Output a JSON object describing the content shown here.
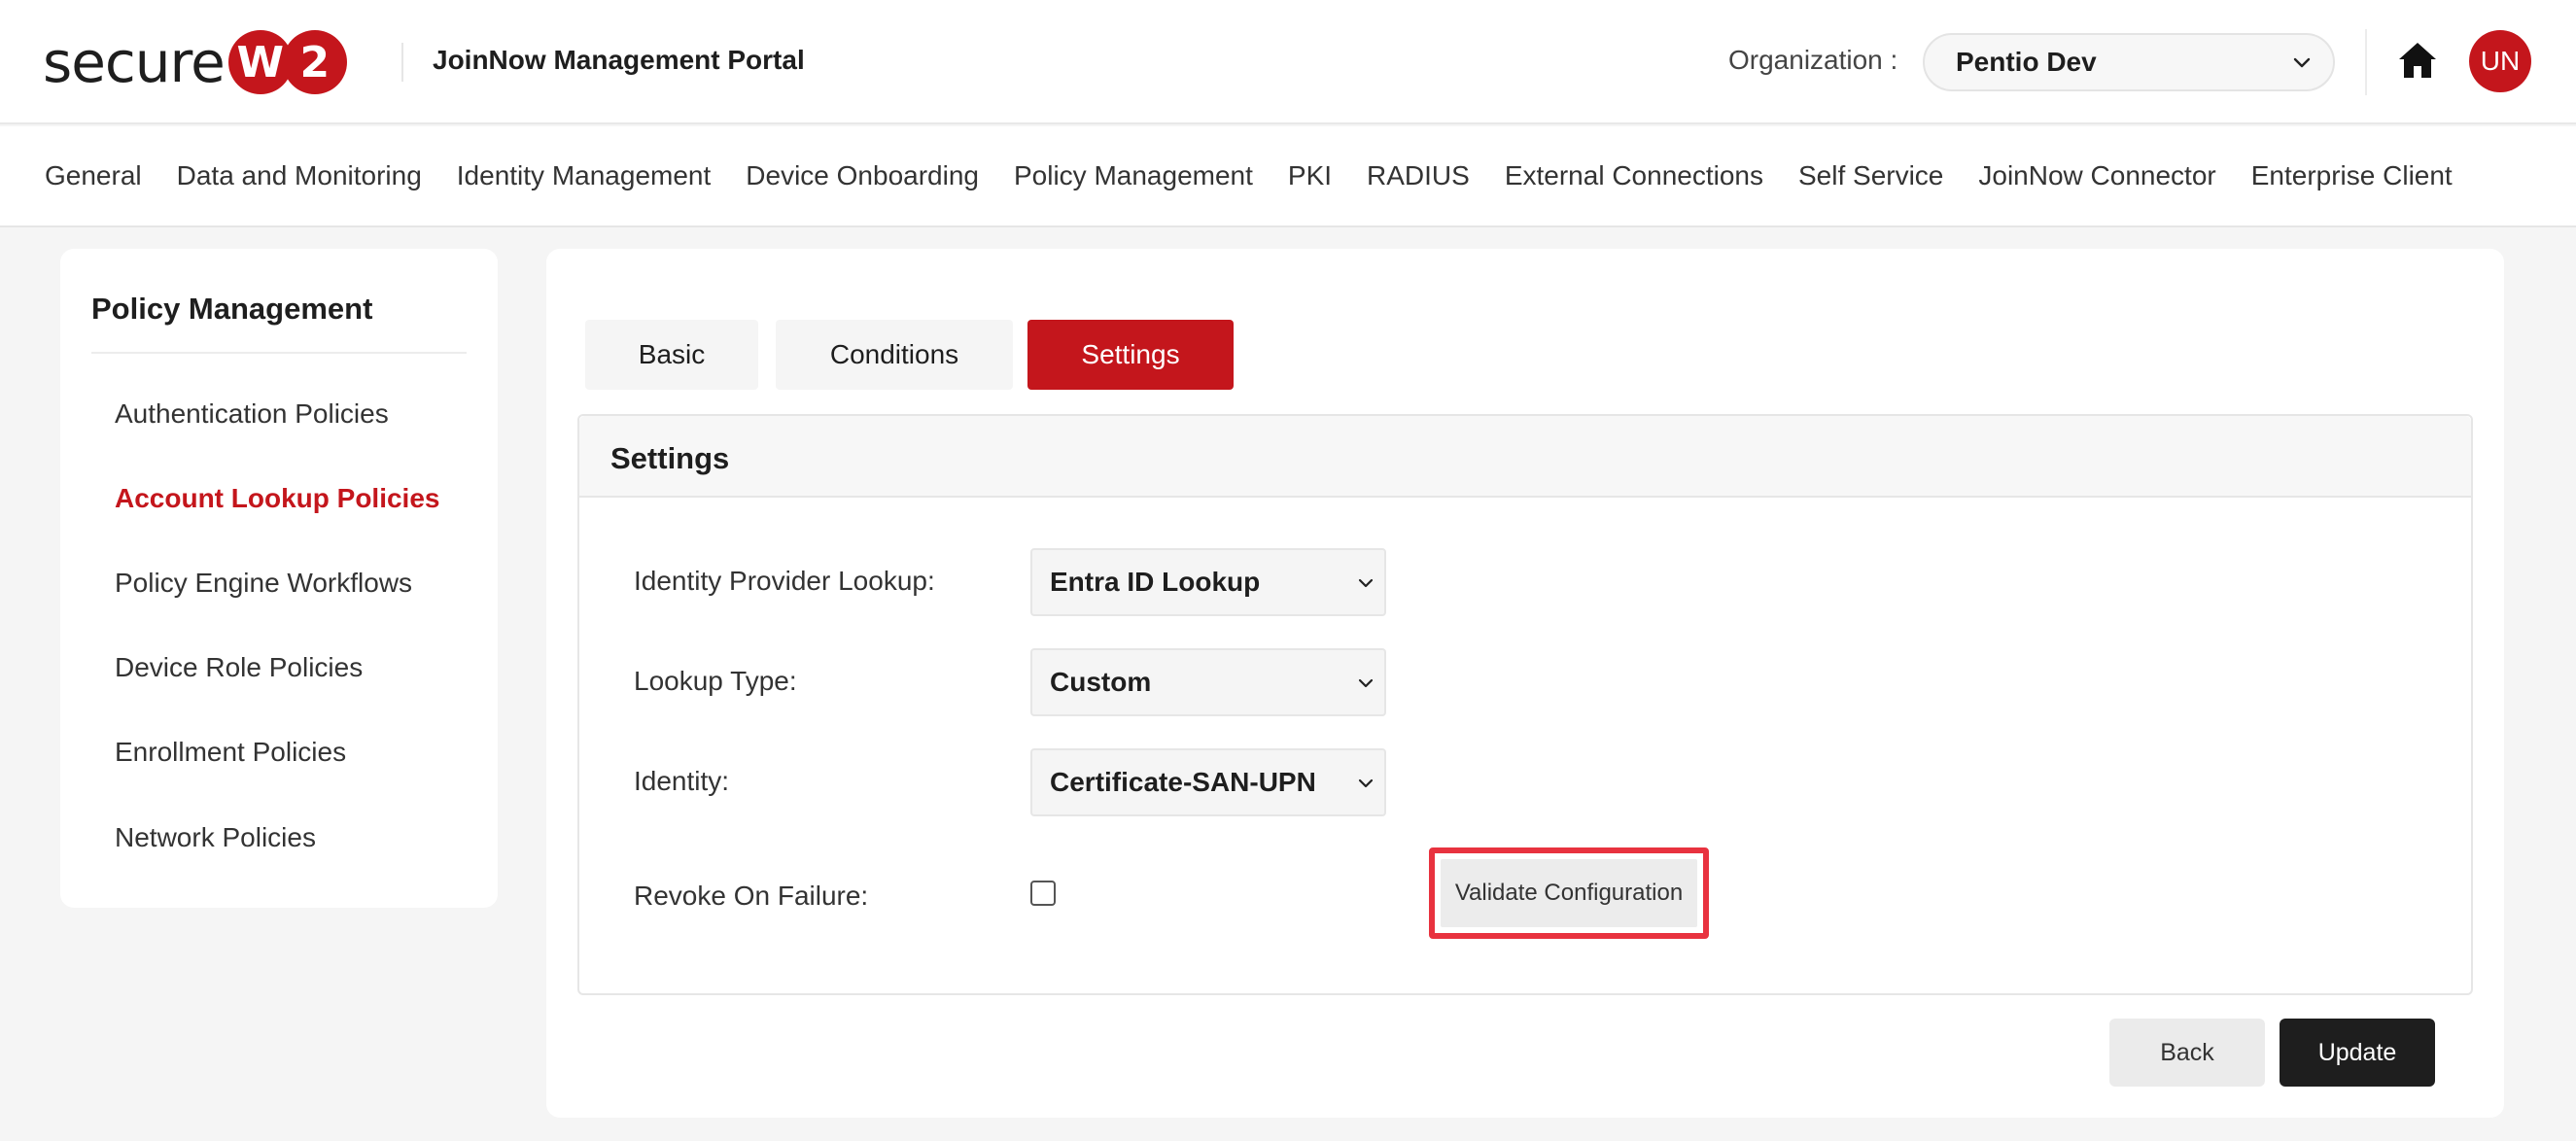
{
  "header": {
    "logo_text": "secure",
    "logo_badge_letter": "W",
    "logo_badge_number": "2",
    "portal_title": "JoinNow Management Portal",
    "org_label": "Organization :",
    "org_value": "Pentio Dev",
    "avatar_initials": "UN",
    "brand_color": "#c4161c"
  },
  "nav": {
    "items": [
      "General",
      "Data and Monitoring",
      "Identity Management",
      "Device Onboarding",
      "Policy Management",
      "PKI",
      "RADIUS",
      "External Connections",
      "Self Service",
      "JoinNow Connector",
      "Enterprise Client"
    ]
  },
  "sidebar": {
    "title": "Policy Management",
    "items": [
      {
        "label": "Authentication Policies",
        "active": false
      },
      {
        "label": "Account Lookup Policies",
        "active": true
      },
      {
        "label": "Policy Engine Workflows",
        "active": false
      },
      {
        "label": "Device Role Policies",
        "active": false
      },
      {
        "label": "Enrollment Policies",
        "active": false
      },
      {
        "label": "Network Policies",
        "active": false
      }
    ]
  },
  "tabs": [
    {
      "label": "Basic",
      "active": false
    },
    {
      "label": "Conditions",
      "active": false
    },
    {
      "label": "Settings",
      "active": true
    }
  ],
  "settings": {
    "title": "Settings",
    "identity_provider_label": "Identity Provider Lookup:",
    "identity_provider_value": "Entra ID Lookup",
    "lookup_type_label": "Lookup Type:",
    "lookup_type_value": "Custom",
    "identity_label": "Identity:",
    "identity_value": "Certificate-SAN-UPN",
    "revoke_label": "Revoke On Failure:",
    "revoke_checked": false,
    "validate_label": "Validate Configuration",
    "highlight_color": "#e8323f"
  },
  "actions": {
    "back_label": "Back",
    "update_label": "Update"
  }
}
